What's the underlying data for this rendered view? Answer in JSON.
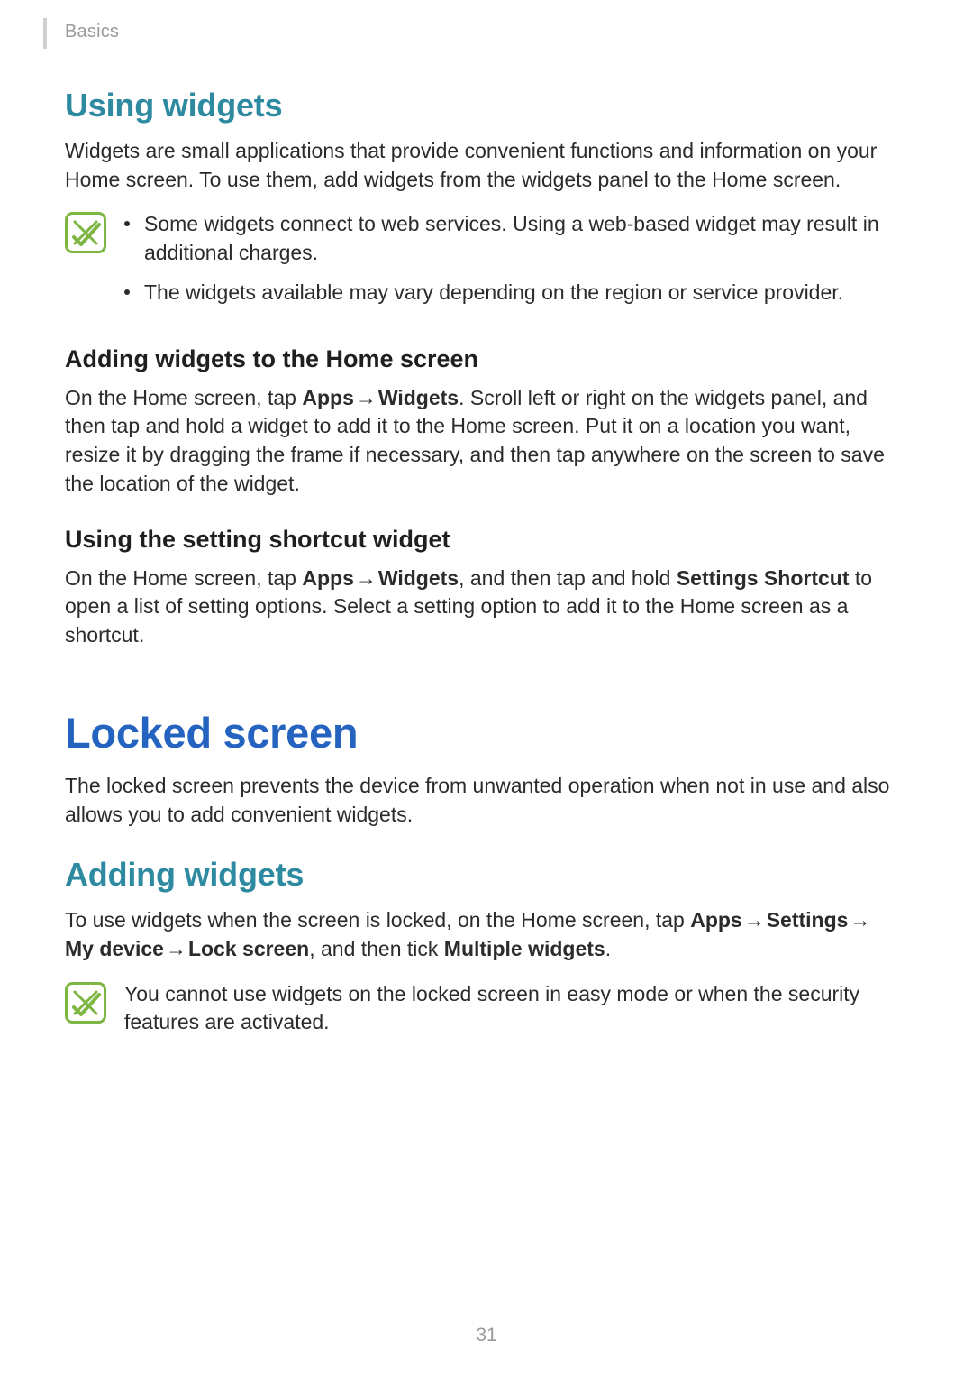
{
  "header": {
    "section": "Basics"
  },
  "section_using_widgets": {
    "title": "Using widgets",
    "intro": "Widgets are small applications that provide convenient functions and information on your Home screen. To use them, add widgets from the widgets panel to the Home screen.",
    "note_bullets": [
      "Some widgets connect to web services. Using a web-based widget may result in additional charges.",
      "The widgets available may vary depending on the region or service provider."
    ],
    "sub_adding": {
      "title": "Adding widgets to the Home screen",
      "para_pre": "On the Home screen, tap ",
      "apps": "Apps",
      "arrow": " → ",
      "widgets": "Widgets",
      "para_post": ". Scroll left or right on the widgets panel, and then tap and hold a widget to add it to the Home screen. Put it on a location you want, resize it by dragging the frame if necessary, and then tap anywhere on the screen to save the location of the widget."
    },
    "sub_shortcut": {
      "title": "Using the setting shortcut widget",
      "para_pre": "On the Home screen, tap ",
      "apps": "Apps",
      "arrow": " → ",
      "widgets": "Widgets",
      "mid": ", and then tap and hold ",
      "settings_shortcut": "Settings Shortcut",
      "para_post": " to open a list of setting options. Select a setting option to add it to the Home screen as a shortcut."
    }
  },
  "section_locked_screen": {
    "title": "Locked screen",
    "intro": "The locked screen prevents the device from unwanted operation when not in use and also allows you to add convenient widgets.",
    "sub_adding": {
      "title": "Adding widgets",
      "pre": "To use widgets when the screen is locked, on the Home screen, tap ",
      "apps": "Apps",
      "arrow": " → ",
      "settings": "Settings",
      "mydevice": "My device",
      "lockscreen": "Lock screen",
      "mid": ", and then tick ",
      "multiple_widgets": "Multiple widgets",
      "period": "."
    },
    "note": "You cannot use widgets on the locked screen in easy mode or when the security features are activated."
  },
  "page_number": "31"
}
